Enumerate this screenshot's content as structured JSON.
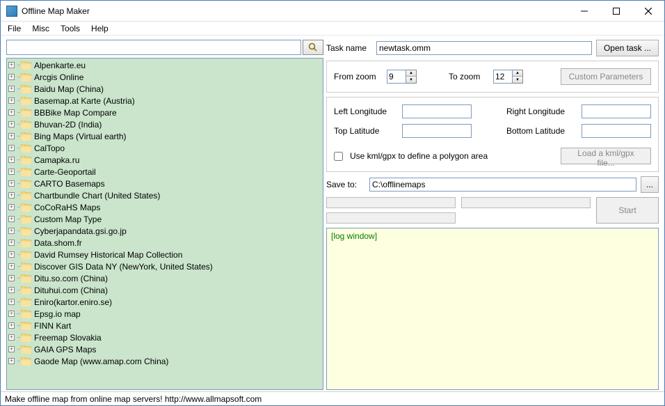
{
  "window": {
    "title": "Offline Map Maker"
  },
  "menu": {
    "file": "File",
    "misc": "Misc",
    "tools": "Tools",
    "help": "Help"
  },
  "search": {
    "placeholder": ""
  },
  "tree": {
    "items": [
      "Alpenkarte.eu",
      "Arcgis Online",
      "Baidu Map (China)",
      "Basemap.at Karte (Austria)",
      "BBBike Map Compare",
      "Bhuvan-2D (India)",
      "Bing Maps (Virtual earth)",
      "CalTopo",
      "Camapka.ru",
      "Carte-Geoportail",
      "CARTO Basemaps",
      "Chartbundle Chart (United States)",
      "CoCoRaHS Maps",
      "Custom Map Type",
      "Cyberjapandata.gsi.go.jp",
      "Data.shom.fr",
      "David Rumsey Historical Map Collection",
      "Discover GIS Data NY (NewYork, United States)",
      "Ditu.so.com (China)",
      "Dituhui.com (China)",
      "Eniro(kartor.eniro.se)",
      "Epsg.io map",
      "FINN Kart",
      "Freemap Slovakia",
      "GAIA GPS Maps",
      "Gaode Map (www.amap.com China)"
    ]
  },
  "task": {
    "name_label": "Task name",
    "name_value": "newtask.omm",
    "open_task": "Open task ..."
  },
  "zoom": {
    "from_label": "From zoom",
    "from_value": "9",
    "to_label": "To zoom",
    "to_value": "12",
    "custom_params": "Custom Parameters"
  },
  "coords": {
    "left_lon_label": "Left Longitude",
    "right_lon_label": "Right Longitude",
    "top_lat_label": "Top Latitude",
    "bottom_lat_label": "Bottom Latitude",
    "use_kml_label": "Use kml/gpx to define a polygon area",
    "load_kml": "Load a kml/gpx file..."
  },
  "save": {
    "label": "Save to:",
    "path": "C:\\offlinemaps",
    "browse": "..."
  },
  "start": {
    "label": "Start"
  },
  "log": {
    "text": "[log window]"
  },
  "status": {
    "text": "Make offline map from online map servers!    http://www.allmapsoft.com"
  }
}
